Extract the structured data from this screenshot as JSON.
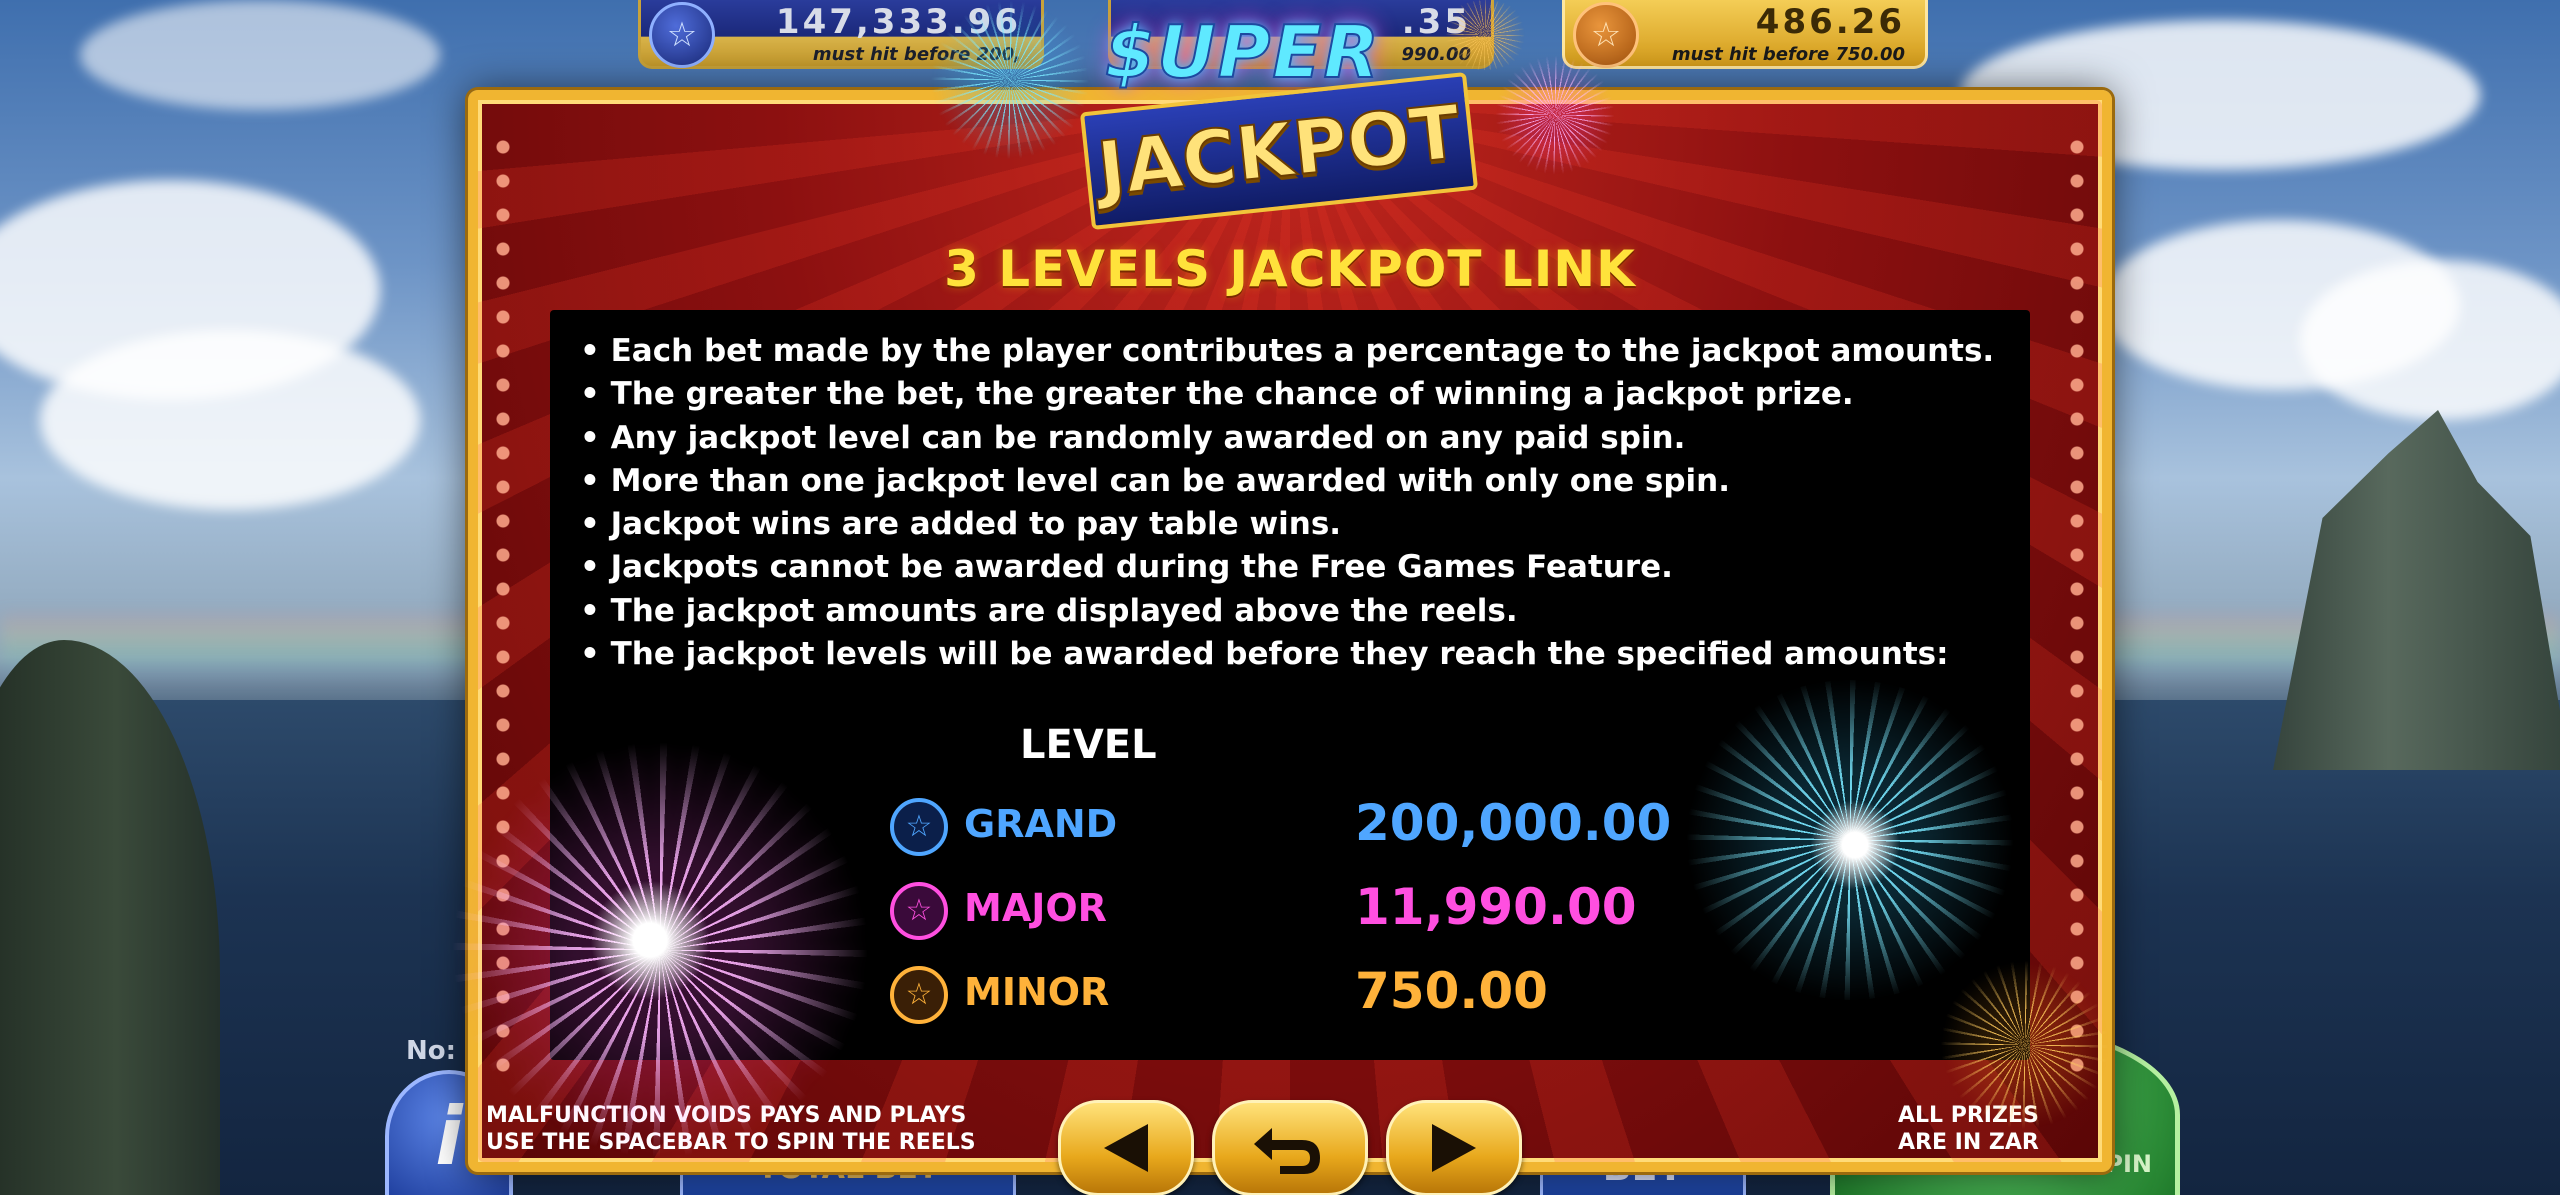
{
  "jackpot_meters": {
    "grand": {
      "value": "147,333.96",
      "subtitle": "must hit before 200,"
    },
    "major": {
      "value": ".35",
      "subtitle": "990.00"
    },
    "minor": {
      "value": "486.26",
      "subtitle": "must hit before 750.00"
    }
  },
  "background_controls": {
    "no_label": "No:",
    "info_label": "i",
    "total_bet_label": "TOTAL BET",
    "bet_label": "BET",
    "spin_label": "HOLD FOR AUTO SPIN"
  },
  "logo": {
    "line1": "$UPER",
    "line2": "JACKPOT"
  },
  "dialog": {
    "title": "3 LEVELS JACKPOT LINK",
    "rules": [
      "Each bet made by the player contributes a percentage to the jackpot amounts.",
      "The greater the bet, the greater the chance of winning a jackpot prize.",
      "Any jackpot level can be randomly awarded on any paid spin.",
      "More than one jackpot level can be awarded with only one spin.",
      "Jackpot wins are added to pay table wins.",
      "Jackpots cannot be awarded during the Free Games Feature.",
      "The jackpot amounts are displayed above the reels.",
      "The jackpot levels will be awarded before they reach the specified amounts:"
    ],
    "level_header": "LEVEL",
    "levels": [
      {
        "name": "GRAND",
        "amount": "200,000.00",
        "color": "#4fa6ff",
        "icon": "star-icon"
      },
      {
        "name": "MAJOR",
        "amount": "11,990.00",
        "color": "#ff4fe0",
        "icon": "star-icon"
      },
      {
        "name": "MINOR",
        "amount": "750.00",
        "color": "#ffb23a",
        "icon": "star-icon"
      }
    ],
    "footer_left": [
      "MALFUNCTION VOIDS PAYS AND PLAYS",
      "USE THE SPACEBAR TO SPIN THE REELS"
    ],
    "footer_right": [
      "ALL PRIZES",
      "ARE IN ZAR"
    ],
    "nav": {
      "prev_icon": "triangle-left-icon",
      "back_icon": "return-arrow-icon",
      "next_icon": "triangle-right-icon"
    }
  },
  "colors": {
    "frame": "#f0b531",
    "title": "#ffe23b",
    "panel": "#000000",
    "dialog_red": "#8c1010"
  }
}
